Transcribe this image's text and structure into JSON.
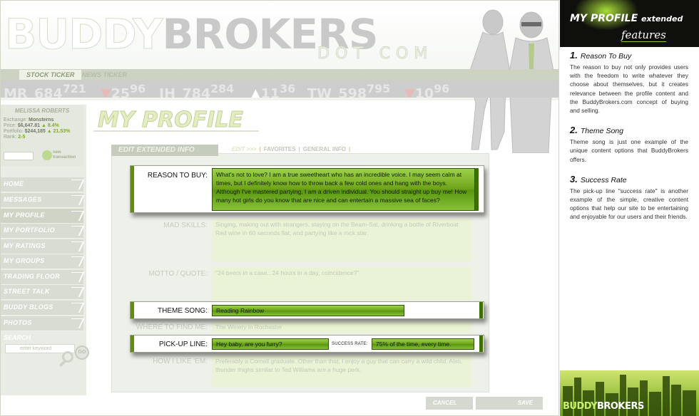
{
  "brand": {
    "logo_part1": "BUDDY",
    "logo_part2": "BROKERS",
    "dotcom": "DOT COM"
  },
  "ticker": {
    "tabs": [
      "STOCK TICKER",
      "NEWS TICKER"
    ],
    "items": [
      {
        "symbol": "MR_684",
        "value": "721",
        "dir": "down",
        "arrow": "▼",
        "change": "25",
        "sub": "96"
      },
      {
        "symbol": "JH_784",
        "value": "284",
        "dir": "up",
        "arrow": "▲",
        "change": "11",
        "sub": "36"
      },
      {
        "symbol": "TW_598",
        "value": "795",
        "dir": "down",
        "arrow": "▼",
        "change": "10",
        "sub": "96"
      }
    ]
  },
  "user": {
    "name": "MELISSA ROBERTS",
    "lines": [
      {
        "label": "Exchange:",
        "value": "Monsterns",
        "extra": ""
      },
      {
        "label": "Price:",
        "value": "$6,647.81",
        "extra": "▲ 8.4%"
      },
      {
        "label": "Portfolio:",
        "value": "$244,185",
        "extra": "▲ 21.53%"
      },
      {
        "label": "Rank:",
        "value": "2-5",
        "extra": ""
      }
    ],
    "new_transaction": "new transaction"
  },
  "nav": [
    "HOME",
    "MESSAGES",
    "MY PROFILE",
    "MY PORTFOLIO",
    "MY RATINGS",
    "MY GROUPS",
    "TRADING FLOOR",
    "STREET TALK",
    "BUDDY BLOGS",
    "PHOTOS"
  ],
  "nav_active": "MY PROFILE",
  "search": {
    "label": "SEARCH",
    "placeholder": "enter keyword",
    "go": "GO"
  },
  "page": {
    "title": "MY PROFILE",
    "edit_tab": "EDIT EXTENDED INFO",
    "tabs": {
      "edit": "EDIT >>>",
      "favorites": "FAVORITES",
      "general": "GENERAL INFO"
    }
  },
  "form": {
    "reason_label": "REASON TO BUY:",
    "reason_value": "What's not to love?  I am a true sweetheart who has an incredible voice.  I may seem calm at times, but I definitely know how to throw back a few cold ones and hang with the boys.  Although I've mastered partying, I am a driven individual. You should straight up buy me! How many hot girls do you know that are nice and can entertain a massive sea of faces?",
    "mad_skills_label": "MAD SKILLS:",
    "mad_skills_value": "Singing, making out with strangers, staying on the Beam-Sat, drinking a bottle of Riverboat Red wine in 60 seconds flat, and partying like a rock star.",
    "motto_label": "MOTTO / QUOTE:",
    "motto_value": "\"24 beers in a case...24 hours in a day, coincidence?\"",
    "theme_label": "THEME SONG:",
    "theme_value": "Reading Rainbow",
    "where_label": "WHERE TO FIND ME:",
    "where_value": "The Winery in Rochester",
    "pickup_label": "PICK-UP LINE:",
    "pickup_value": "Hey baby, are you furry?",
    "success_rate_label": "SUCCESS RATE:",
    "success_rate_value": "75% of the time, every time.",
    "how_like_label": "HOW I LIKE 'EM:",
    "how_like_value": "Preferably a Cornell graduate. Other than that, I enjoy a guy that can carry a wild child. Also, thunder thighs similar to Ted Williams are a huge perk."
  },
  "buttons": {
    "cancel": "CANCEL",
    "save": "SAVE"
  },
  "right_panel": {
    "title": "MY PROFILE",
    "title_ext": "extended",
    "subtitle": "features",
    "features": [
      {
        "num": "1.",
        "title": "Reason To Buy",
        "text": "The reason to buy not only provides users with the freedom to write whatever they choose about themselves, but it creates relevance between the profile content and the BuddyBrokers.com concept of buying and selling."
      },
      {
        "num": "2.",
        "title": "Theme Song",
        "text": "Theme song is just one example of the unique content options that BuddyBrokers offers."
      },
      {
        "num": "3.",
        "title": "Success Rate",
        "text": "The pick-up line \"success rate\" is another example of the simple, creative content options that help our site to be entertaining and enjoyable for our users and their friends."
      }
    ],
    "footer_logo_a": "BUDDY",
    "footer_logo_b": "BROKERS"
  },
  "colors": {
    "accent_green": "#7fb12a",
    "dark_green": "#3d6f08",
    "panel_black": "#0f0f0c"
  }
}
